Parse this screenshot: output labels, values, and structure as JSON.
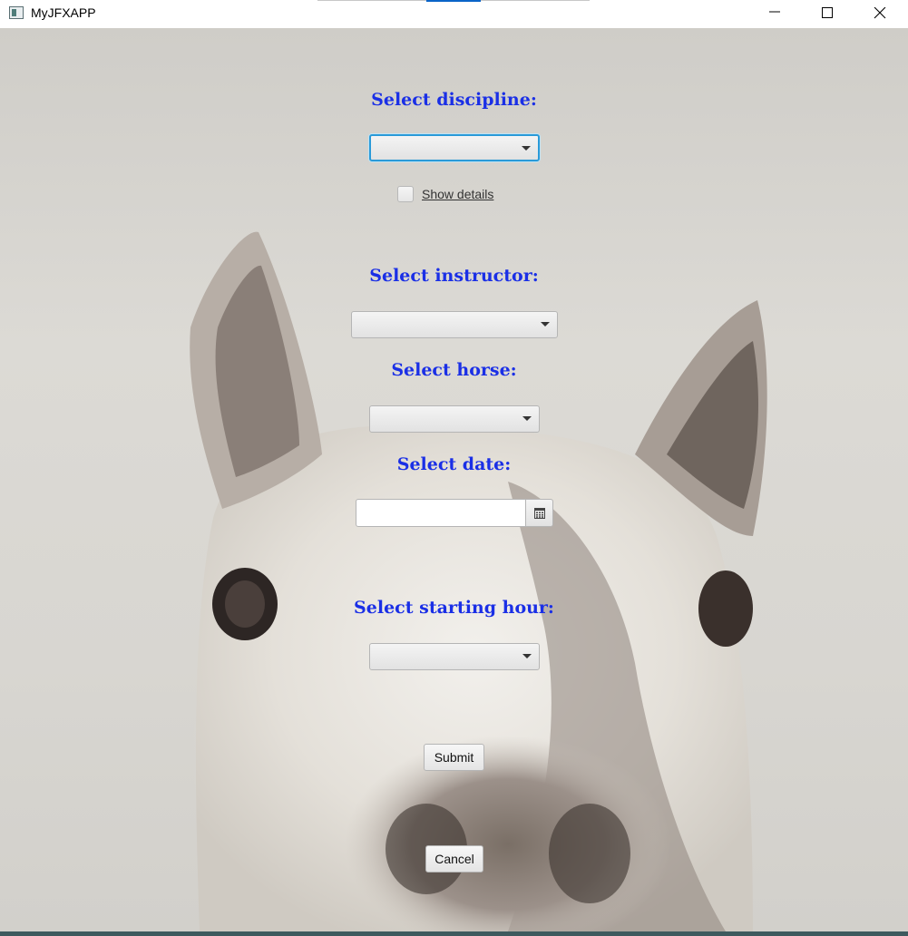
{
  "window": {
    "title": "MyJFXAPP"
  },
  "form": {
    "discipline": {
      "label": "Select discipline:",
      "selected": ""
    },
    "show_details": {
      "label": "Show details",
      "checked": false
    },
    "instructor": {
      "label": "Select instructor:",
      "selected": ""
    },
    "horse": {
      "label": "Select horse:",
      "selected": ""
    },
    "date": {
      "label": "Select date:",
      "value": ""
    },
    "starting_hour": {
      "label": "Select starting hour:",
      "selected": ""
    },
    "submit_label": "Submit",
    "cancel_label": "Cancel"
  },
  "colors": {
    "label_color": "#1a2fe6",
    "focus_ring": "#2a9ad8"
  },
  "icons": [
    "app-icon",
    "minimize-icon",
    "maximize-icon",
    "close-icon",
    "chevron-down-icon",
    "calendar-icon"
  ]
}
